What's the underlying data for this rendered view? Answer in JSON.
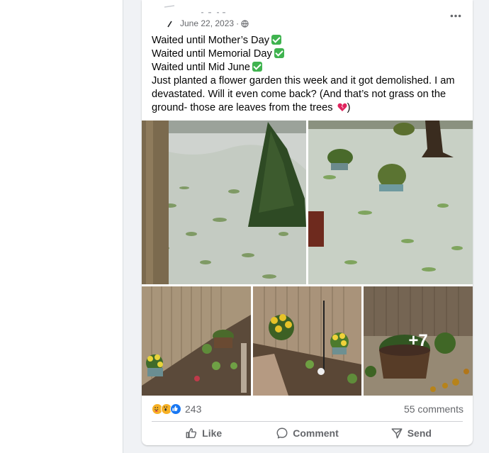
{
  "post": {
    "date": "June 22, 2023",
    "separator": "·",
    "lines": [
      "Waited until Mother’s Day",
      "Waited until Memorial Day",
      "Waited until Mid June",
      "Just planted a flower garden this week and it got demolished. I am devastated. Will it even come back? (And that’s not grass on the ground- those are leaves from the trees",
      ")"
    ],
    "icons": {
      "check": "check-mark-emoji",
      "heart": "broken-heart-emoji",
      "privacy": "globe-icon",
      "more": "more-options-icon"
    },
    "photos_more": "+7"
  },
  "engagement": {
    "reaction_count": "243",
    "comments": "55 comments",
    "reactions": [
      "care",
      "wow",
      "like"
    ]
  },
  "actions": {
    "like": "Like",
    "comment": "Comment",
    "send": "Send"
  },
  "colors": {
    "accent": "#1877f2",
    "secondary_text": "#65676b",
    "check_green": "#3fb34f",
    "heart_red": "#e0245e"
  }
}
